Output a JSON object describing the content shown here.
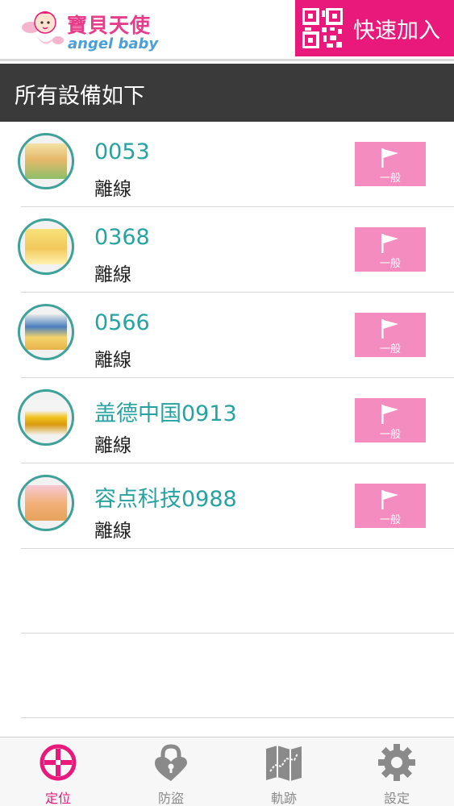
{
  "header": {
    "logo_title": "寶貝天使",
    "logo_sub": "angel baby",
    "quick_add_label": "快速加入"
  },
  "title_bar": {
    "title": "所有設備如下"
  },
  "devices": [
    {
      "name": "0053",
      "status": "離線",
      "button_label": "一般"
    },
    {
      "name": "0368",
      "status": "離線",
      "button_label": "一般"
    },
    {
      "name": "0566",
      "status": "離線",
      "button_label": "一般"
    },
    {
      "name": "盖德中国0913",
      "status": "離線",
      "button_label": "一般"
    },
    {
      "name": "容点科技0988",
      "status": "離線",
      "button_label": "一般"
    }
  ],
  "tabs": [
    {
      "label": "定位",
      "icon": "locate-icon",
      "active": true
    },
    {
      "label": "防盜",
      "icon": "lock-icon",
      "active": false
    },
    {
      "label": "軌跡",
      "icon": "map-icon",
      "active": false
    },
    {
      "label": "設定",
      "icon": "gear-icon",
      "active": false
    }
  ],
  "colors": {
    "accent": "#e8197a",
    "teal": "#26a3a0",
    "button_pink": "#f58cbf",
    "title_bar": "#3a3a3a"
  }
}
